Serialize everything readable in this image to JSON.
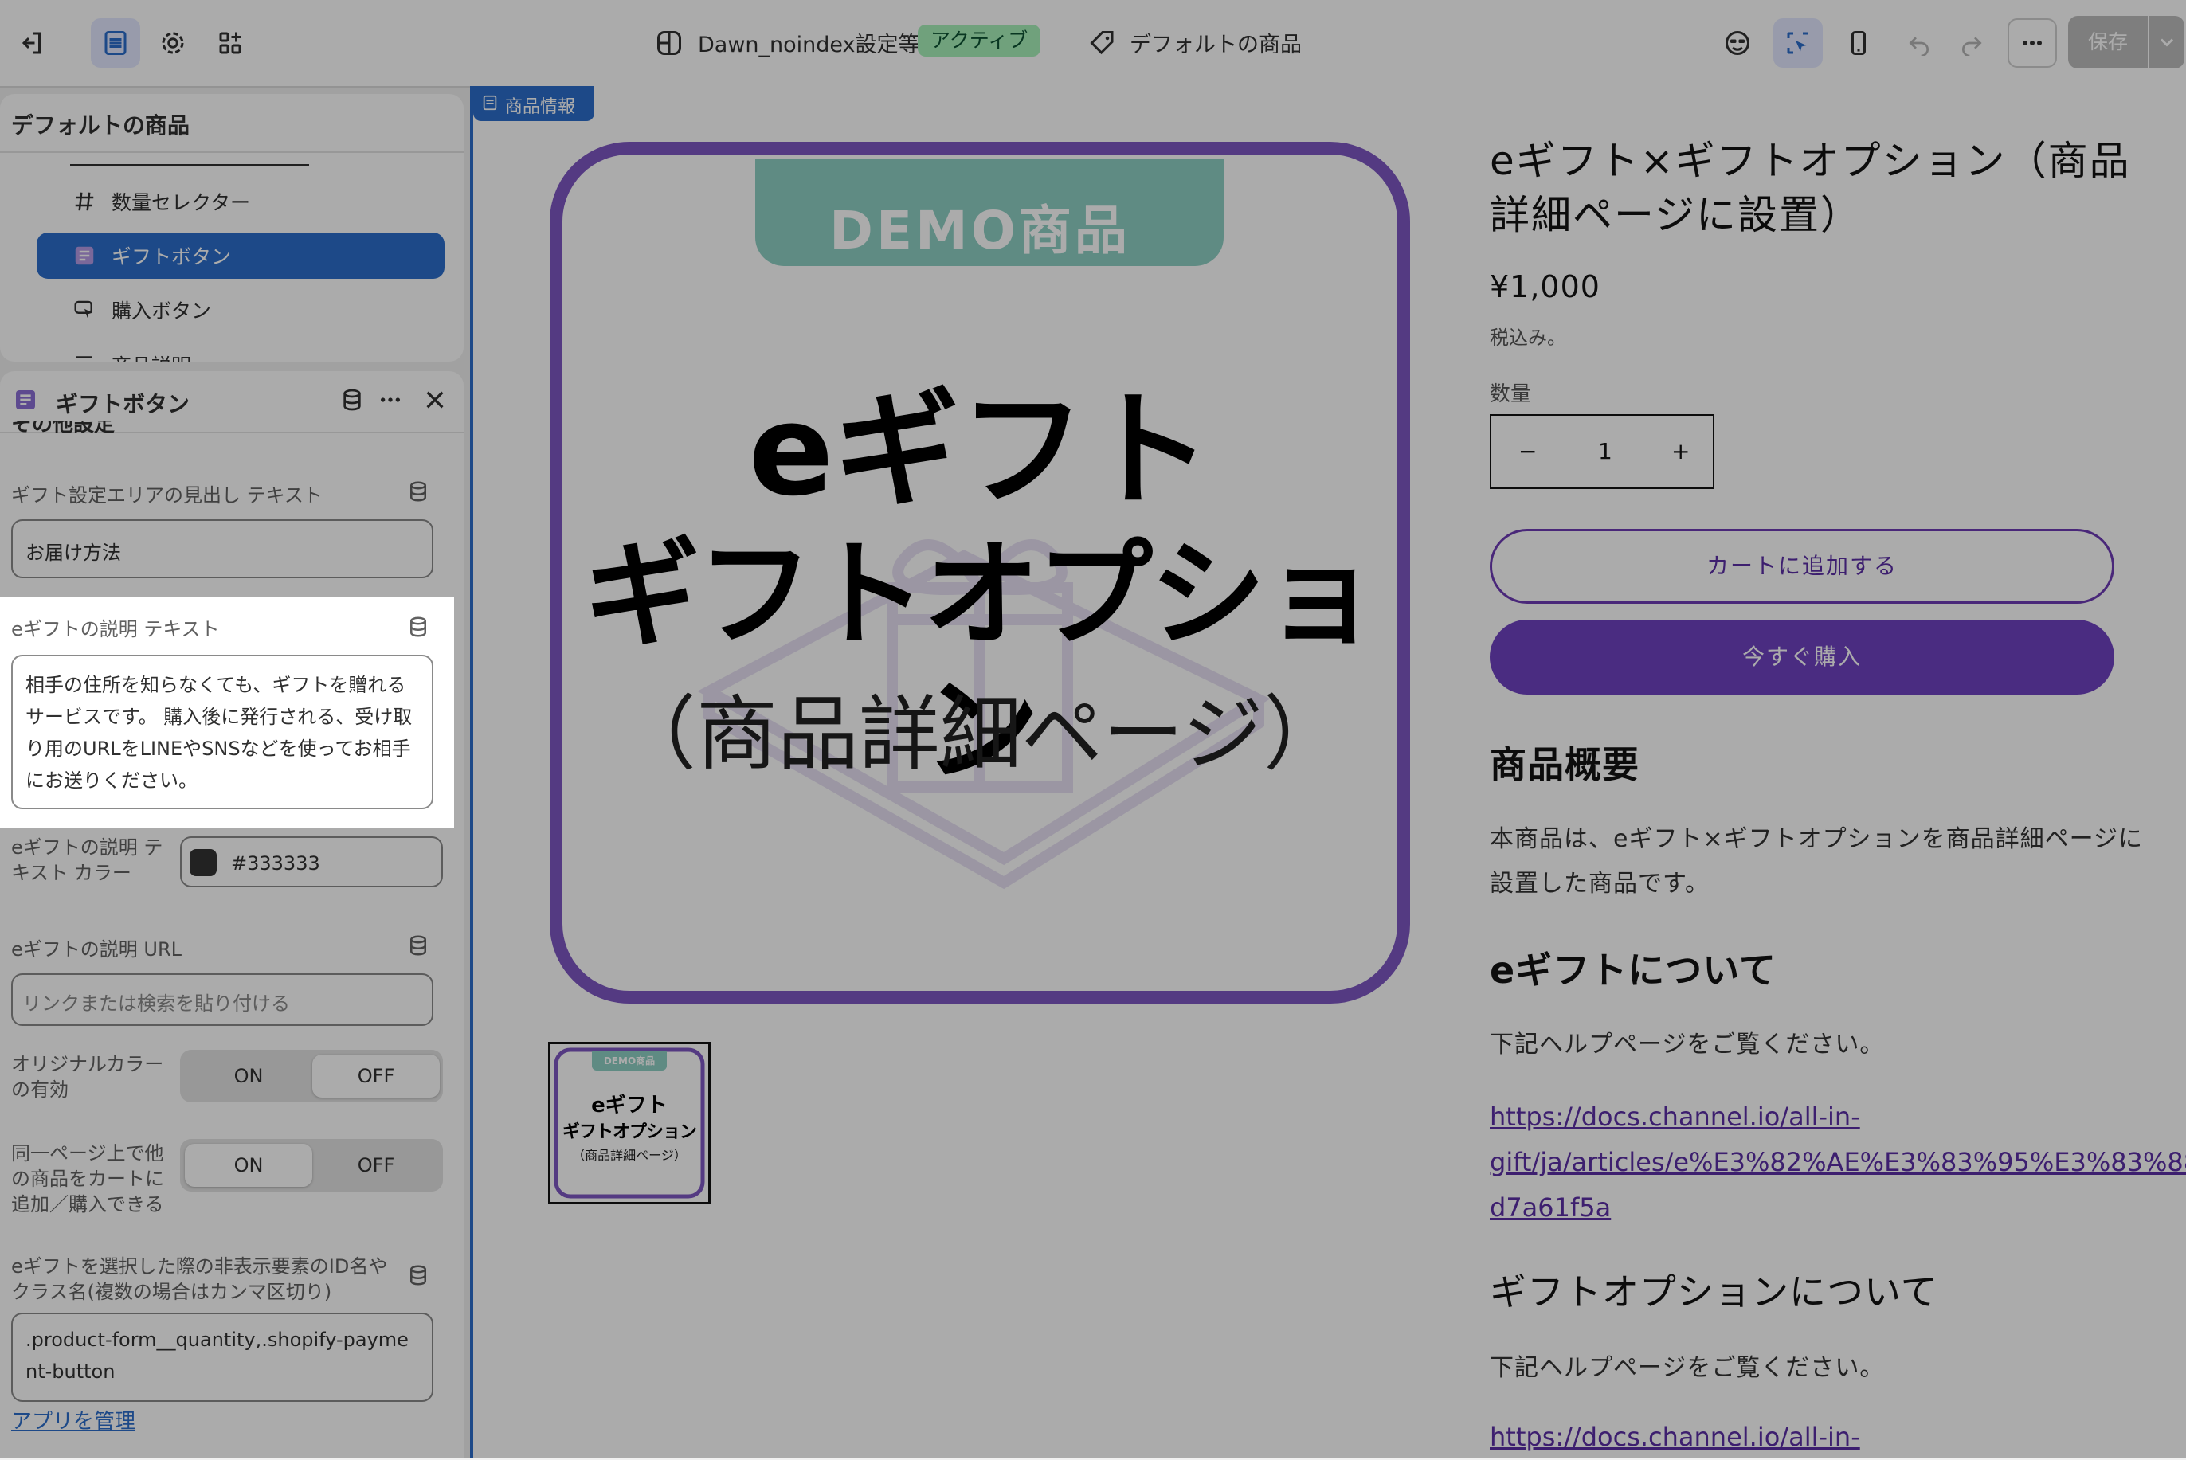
{
  "topbar": {
    "theme_name": "Dawn_noindex設定等",
    "theme_status": "アクティブ",
    "template_name": "デフォルトの商品",
    "save_label": "保存"
  },
  "tree_panel": {
    "title": "デフォルトの商品",
    "items": [
      {
        "label": "数量セレクター",
        "icon": "hash-icon"
      },
      {
        "label": "ギフトボタン",
        "icon": "app-block-icon",
        "selected": true
      },
      {
        "label": "購入ボタン",
        "icon": "cursor-click-icon"
      },
      {
        "label": "商品説明",
        "icon": "text-lines-icon"
      }
    ]
  },
  "settings_panel": {
    "title": "ギフトボタン",
    "section_heading_partial": "その他設定",
    "heading_text_label": "ギフト設定エリアの見出し テキスト",
    "heading_text_value": "お届け方法",
    "desc_text_label": "eギフトの説明 テキスト",
    "desc_text_value": "相手の住所を知らなくても、ギフトを贈れるサービスです。 購入後に発行される、受け取り用のURLをLINEやSNSなどを使ってお相手にお送りください。",
    "desc_color_label": "eギフトの説明 テキスト カラー",
    "desc_color_value": "#333333",
    "desc_color_swatch": "#333333",
    "desc_url_label": "eギフトの説明 URL",
    "desc_url_placeholder": "リンクまたは検索を貼り付ける",
    "original_color_label": "オリジナルカラーの有効",
    "same_page_label": "同一ページ上で他の商品をカートに追加／購入できる",
    "toggle_on": "ON",
    "toggle_off": "OFF",
    "hidden_ids_label": "eギフトを選択した際の非表示要素のID名やクラス名(複数の場合はカンマ区切り)",
    "hidden_ids_value": ".product-form__quantity,.shopify-payment-button",
    "manage_app_link": "アプリを管理"
  },
  "preview": {
    "section_tag": "商品情報",
    "image": {
      "badge": "DEMO商品",
      "line1": "eギフト",
      "line2": "ギフトオプション",
      "line3": "（商品詳細ページ）"
    },
    "thumb": {
      "badge": "DEMO商品",
      "line1": "eギフト",
      "line2": "ギフトオプション",
      "line3": "（商品詳細ページ）"
    },
    "product_title": "eギフト×ギフトオプション（商品詳細ページに設置）",
    "price": "¥1,000",
    "tax_note": "税込み。",
    "quantity_label": "数量",
    "quantity_value": "1",
    "minus": "−",
    "plus": "+",
    "add_to_cart": "カートに追加する",
    "buy_now": "今すぐ購入",
    "overview_heading": "商品概要",
    "overview_text": "本商品は、eギフト×ギフトオプションを商品詳細ページに設置した商品です。",
    "egift_heading": "eギフトについて",
    "egift_text": "下記ヘルプページをご覧ください。",
    "egift_link_1": "https://docs.channel.io/all-in-",
    "egift_link_2": "gift/ja/articles/e%E3%82%AE%E3%83%95%E3%83%88",
    "egift_link_3": "d7a61f5a",
    "giftopt_heading": "ギフトオプションについて",
    "giftopt_text": "下記ヘルプページをご覧ください。",
    "giftopt_link_1": "https://docs.channel.io/all-in-"
  },
  "colors": {
    "accent_blue": "#2c6ecb",
    "brand_purple": "#6f42c1",
    "demo_teal": "#8ecfc4",
    "active_badge": "#a7f0ba"
  }
}
